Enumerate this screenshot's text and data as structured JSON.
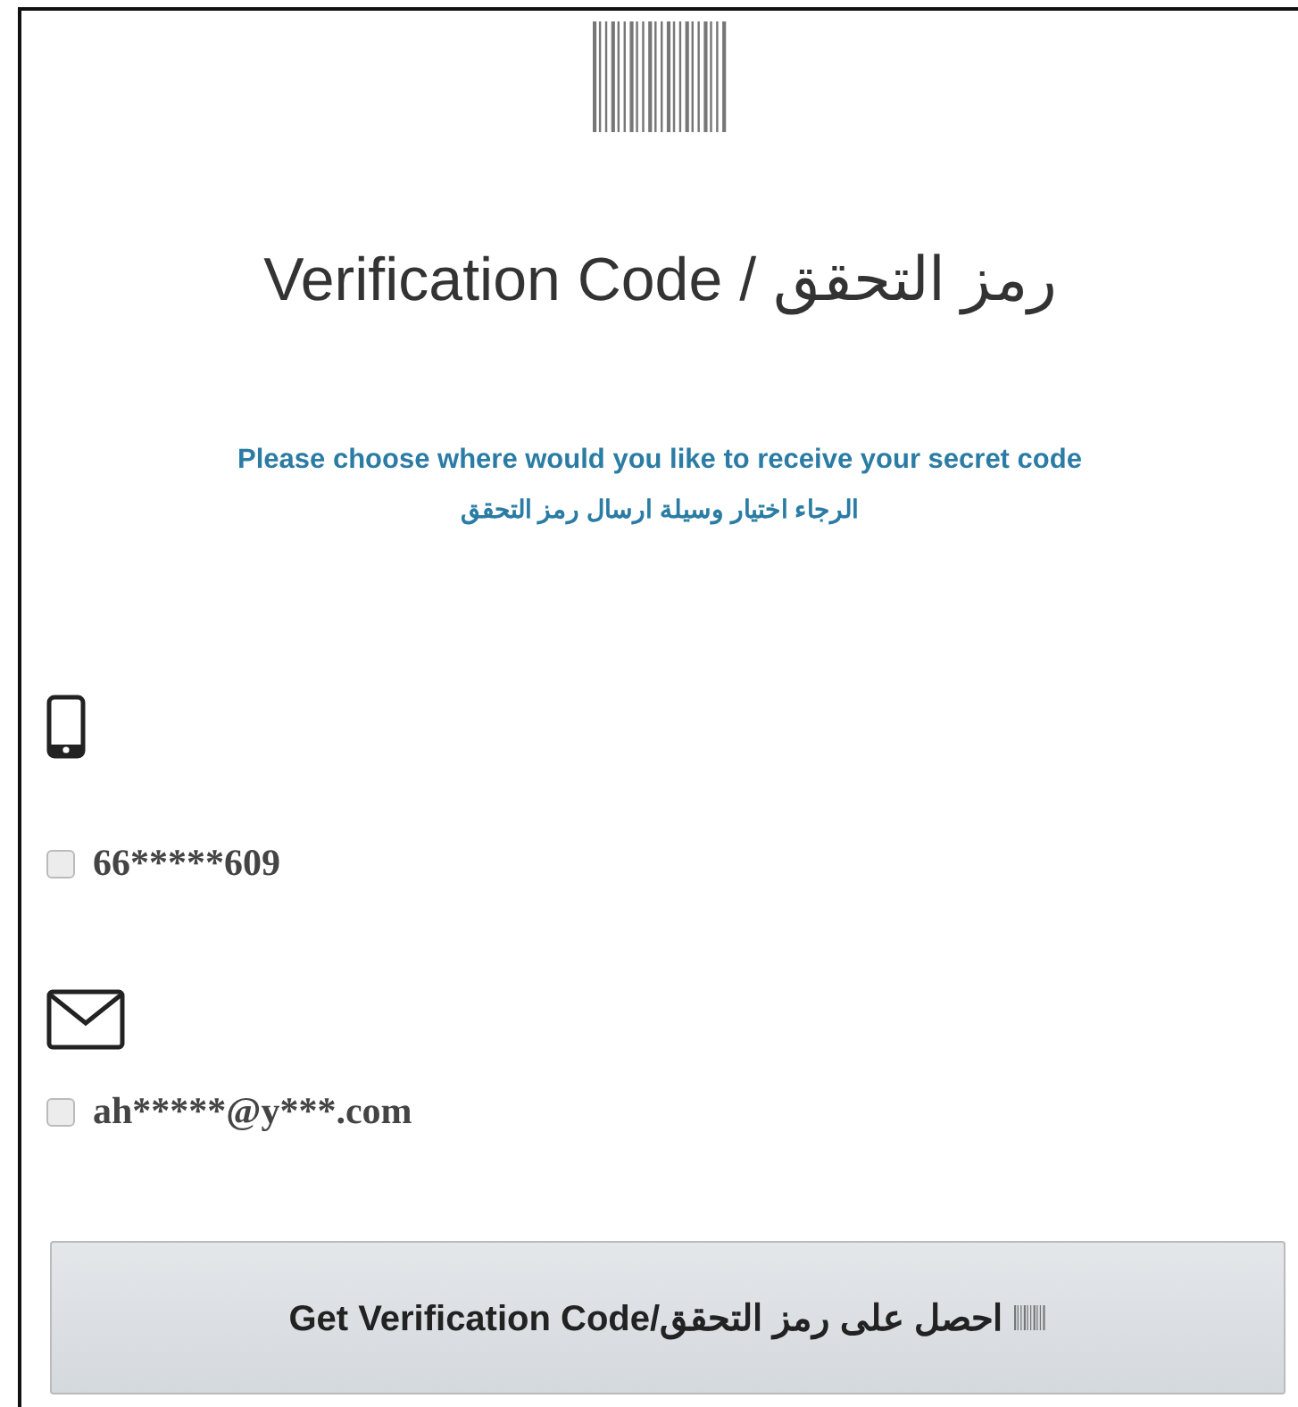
{
  "title": "Verification Code / رمز التحقق",
  "instructions": [
    "Please choose where would you like to receive your secret code",
    "الرجاء اختيار وسيلة ارسال رمز التحقق"
  ],
  "options": [
    {
      "kind": "phone",
      "label": "66*****609",
      "checked": false
    },
    {
      "kind": "email",
      "label": "ah*****@y***.com",
      "checked": false
    }
  ],
  "button": {
    "label": "Get Verification Code/احصل على رمز التحقق"
  }
}
